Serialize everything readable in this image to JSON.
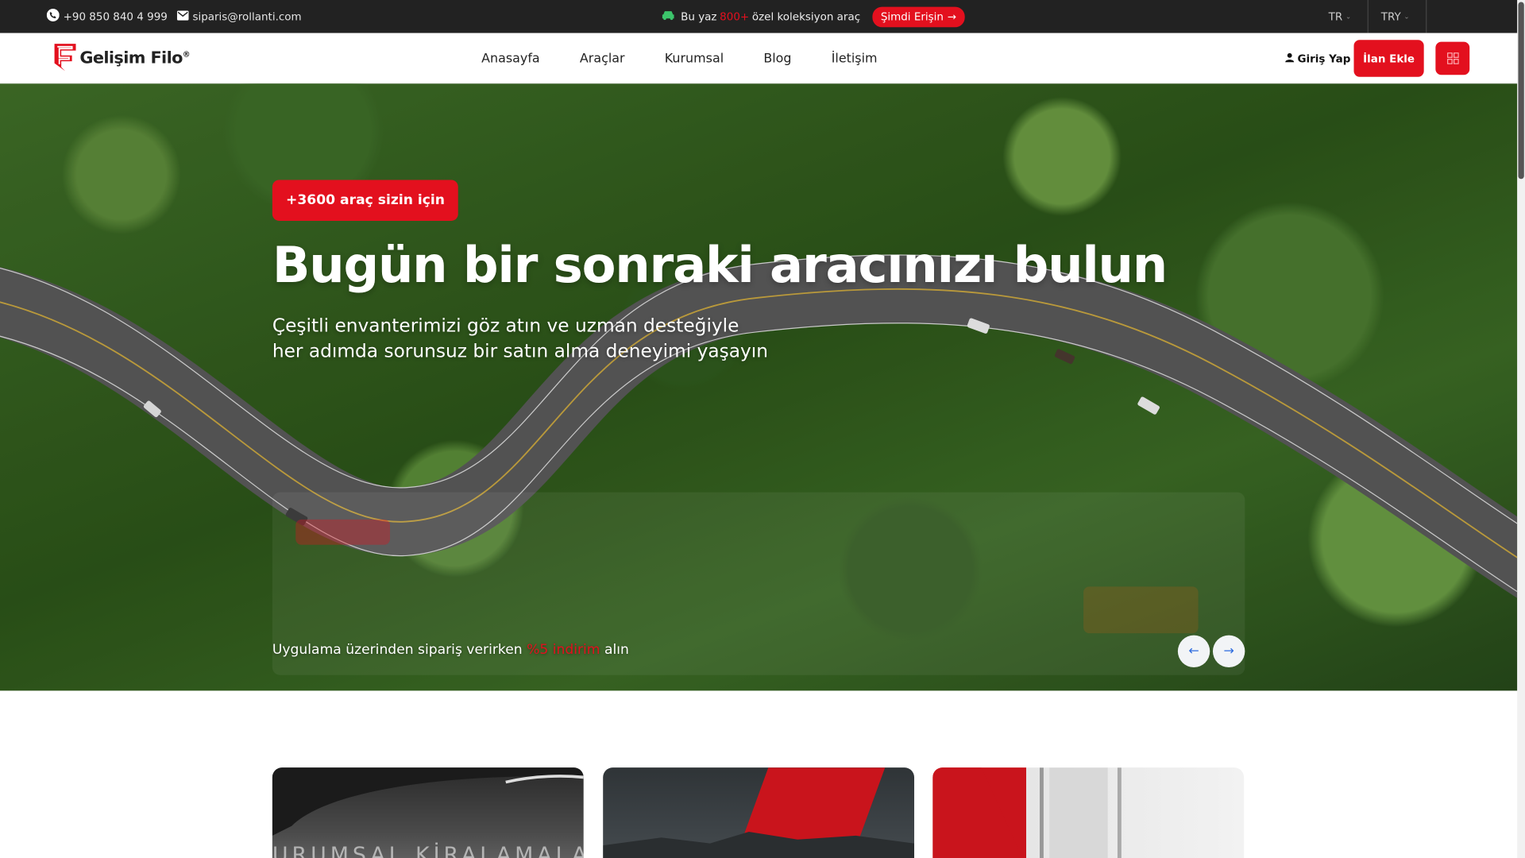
{
  "topbar": {
    "phone": "+90 850 840 4 999",
    "email": "siparis@rollanti.com",
    "promo_prefix": "Bu yaz",
    "promo_count": "800+",
    "promo_suffix": "özel koleksiyon araç",
    "access_button": "Şimdi Erişin",
    "language": "TR",
    "currency": "TRY"
  },
  "header": {
    "logo_text": "Gelişim Filo",
    "nav": [
      "Anasayfa",
      "Araçlar",
      "Kurumsal",
      "Blog",
      "İletişim"
    ],
    "login_label": "Giriş Yap",
    "add_listing_label": "İlan Ekle"
  },
  "hero": {
    "badge": "+3600 araç sizin için",
    "title": "Bugün bir sonraki aracınızı bulun",
    "subtitle_line1": "Çeşitli envanterimizi göz atın ve uzman desteğiyle",
    "subtitle_line2": "her adımda sorunsuz bir satın alma deneyimi yaşayın",
    "promo_prefix": "Uygulama üzerinden sipariş verirken",
    "promo_highlight": "%5 indirim",
    "promo_suffix": "alın"
  },
  "cards": {
    "card1_text": "URUMSAL KİRALAMALAR"
  },
  "colors": {
    "accent": "#e3101e",
    "topbar_bg": "#222222"
  }
}
